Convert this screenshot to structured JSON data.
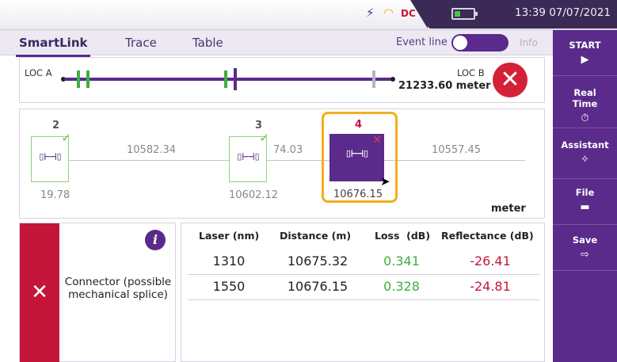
{
  "status_bar": {
    "time": "13:39 07/07/2021",
    "icons": [
      "usb-icon",
      "wifi-icon",
      "dc-icon",
      "battery-icon"
    ]
  },
  "tabs": {
    "items": [
      {
        "label": "SmartLink",
        "active": true
      },
      {
        "label": "Trace",
        "active": false
      },
      {
        "label": "Table",
        "active": false
      }
    ],
    "event_line_label": "Event line",
    "event_line_on": true,
    "info_label": "Info"
  },
  "link_overview": {
    "loc_a": "LOC A",
    "loc_b": "LOC B",
    "total_distance": "21233.60 meter"
  },
  "event_chain": {
    "events": [
      {
        "number": "2",
        "position": "19.78",
        "status": "pass",
        "icon": "connector-icon"
      },
      {
        "number": "3",
        "position": "10602.12",
        "status": "pass",
        "icon": "connector-icon"
      },
      {
        "number": "4",
        "position": "10676.15",
        "status": "fail",
        "icon": "connector-icon",
        "selected": true
      }
    ],
    "segments": [
      "10582.34",
      "74.03",
      "10557.45"
    ],
    "unit": "meter"
  },
  "detail": {
    "status": "fail",
    "description": "Connector (possible mechanical splice)",
    "info_symbol": "i"
  },
  "results_table": {
    "headers": [
      "Laser (nm)",
      "Distance (m)",
      "Loss  (dB)",
      "Reflectance (dB)"
    ],
    "rows": [
      {
        "laser": "1310",
        "distance": "10675.32",
        "loss": "0.341",
        "reflectance": "-26.41"
      },
      {
        "laser": "1550",
        "distance": "10676.15",
        "loss": "0.328",
        "reflectance": "-24.81"
      }
    ]
  },
  "sidebar": {
    "buttons": [
      {
        "label": "START",
        "icon": "play-icon"
      },
      {
        "label": "Real Time",
        "icon": "stopwatch-icon"
      },
      {
        "label": "Assistant",
        "icon": "wand-icon"
      },
      {
        "label": "File",
        "icon": "folder-icon"
      },
      {
        "label": "Save",
        "icon": "save-icon"
      }
    ]
  },
  "colors": {
    "accent": "#5a2b8a",
    "fail": "#c4163a",
    "pass": "#6cc04a",
    "highlight": "#f3ae1b"
  }
}
